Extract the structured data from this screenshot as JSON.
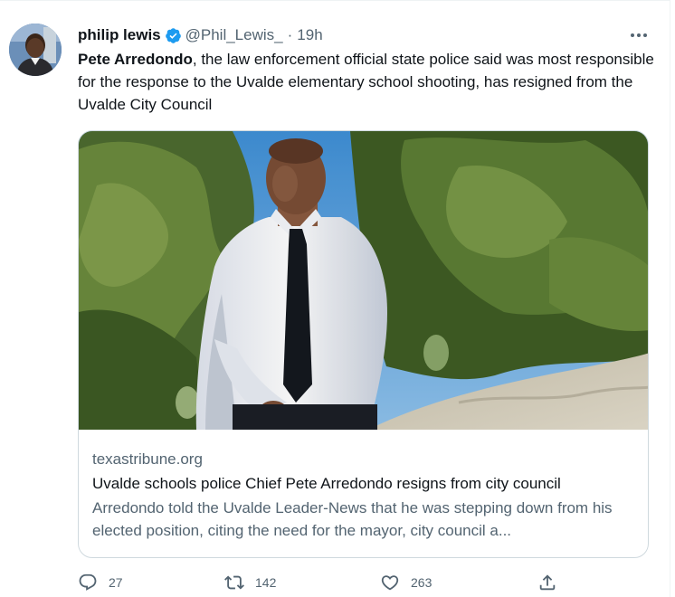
{
  "author": {
    "name": "philip lewis",
    "handle": "@Phil_Lewis_",
    "separator": "·",
    "time": "19h",
    "verified_icon": "verified-badge-icon",
    "avatar_icon": "avatar"
  },
  "tweet": {
    "text_bold": "Pete Arredondo",
    "text_rest": ", the law enforcement official state police said was most responsible for the response to the Uvalde elementary school shooting, has resigned from the Uvalde City Council"
  },
  "card": {
    "domain": "texastribune.org",
    "title": "Uvalde schools police Chief Pete Arredondo resigns from city council",
    "description": "Arredondo told the Uvalde Leader-News that he was stepping down from his elected position, citing the need for the mayor, city council a..."
  },
  "actions": {
    "replies": "27",
    "retweets": "142",
    "likes": "263"
  },
  "colors": {
    "text": "#0f1419",
    "secondary": "#536471",
    "verified": "#1d9bf0",
    "border": "#cfd9de"
  }
}
